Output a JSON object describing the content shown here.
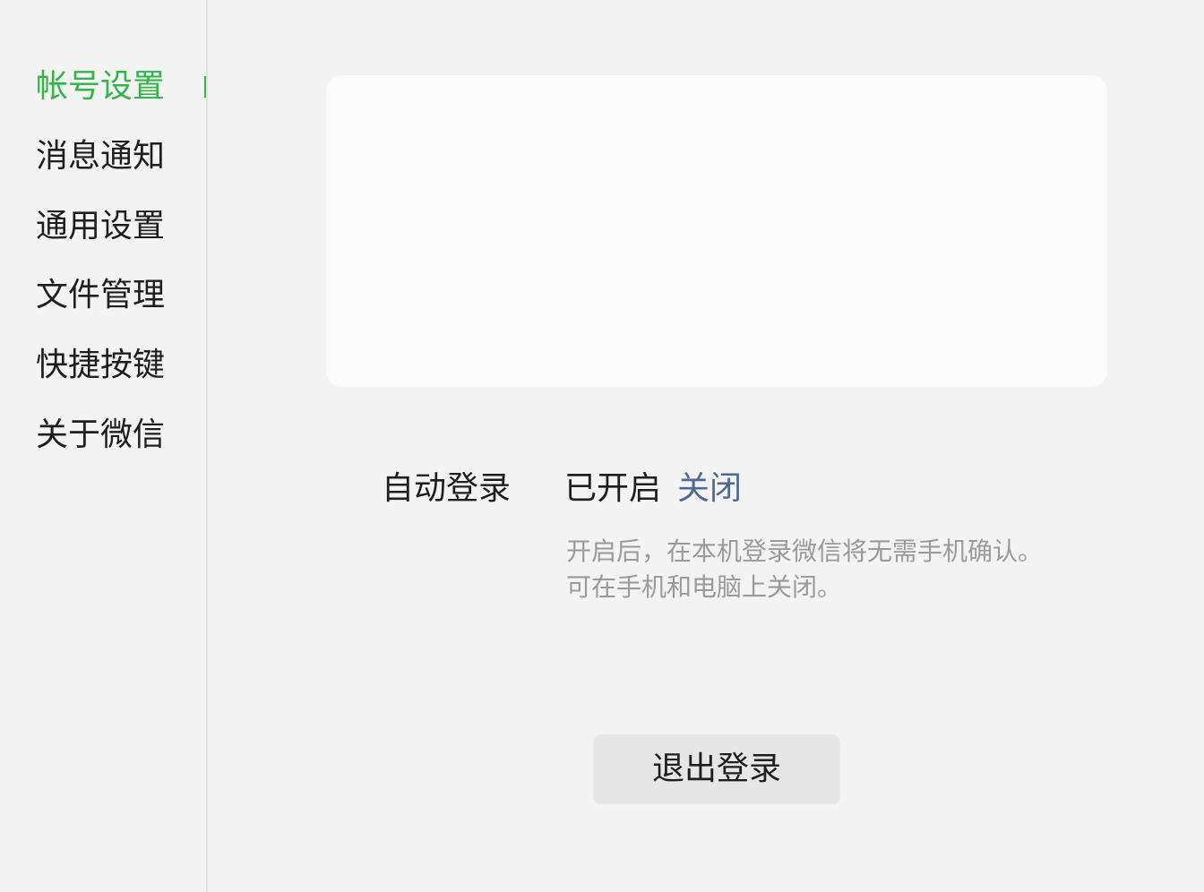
{
  "sidebar": {
    "items": [
      {
        "label": "帐号设置",
        "active": true
      },
      {
        "label": "消息通知"
      },
      {
        "label": "通用设置"
      },
      {
        "label": "文件管理"
      },
      {
        "label": "快捷按键"
      },
      {
        "label": "关于微信"
      }
    ]
  },
  "colors": {
    "accent": "#33b54a",
    "link": "#4f6a92",
    "hint": "#9a9a9a"
  },
  "auto_login": {
    "label": "自动登录",
    "status": "已开启",
    "action": "关闭",
    "hint_line1": "开启后，在本机登录微信将无需手机确认。",
    "hint_line2": "可在手机和电脑上关闭。"
  },
  "logout": {
    "label": "退出登录"
  }
}
